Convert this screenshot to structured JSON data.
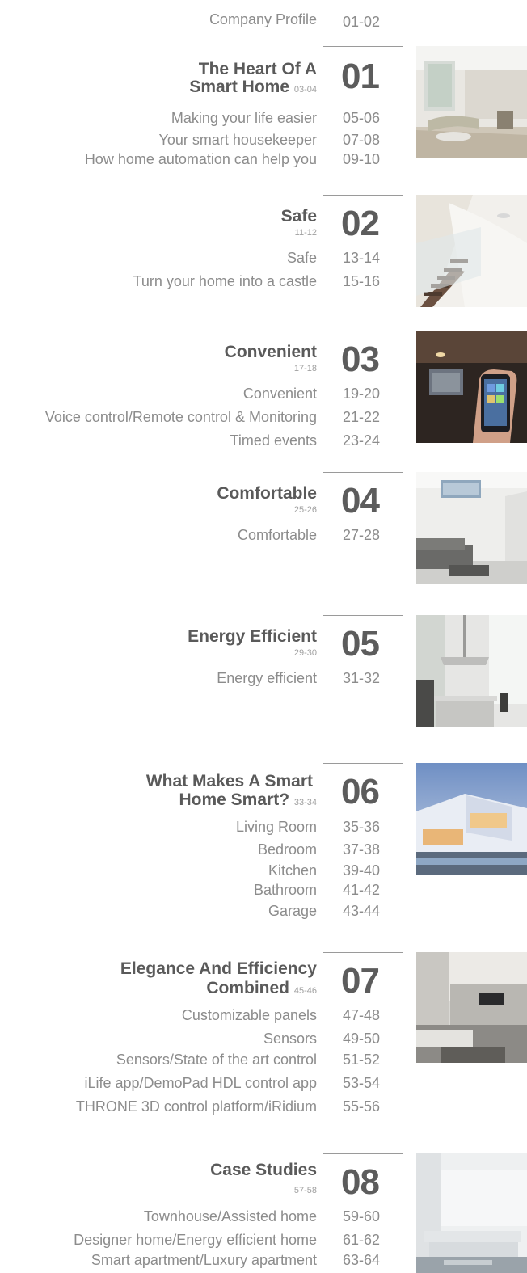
{
  "profile": {
    "label": "Company Profile",
    "pages": "01-02"
  },
  "sections": [
    {
      "num": "01",
      "title_lines": [
        "The Heart Of A",
        "Smart Home"
      ],
      "title_pages": "03-04",
      "items": [
        {
          "label": "Making your life easier",
          "pages": "05-06"
        },
        {
          "label": "Your smart housekeeper",
          "pages": "07-08"
        },
        {
          "label": "How home automation can help you",
          "pages": "09-10"
        }
      ]
    },
    {
      "num": "02",
      "title_lines": [
        "Safe"
      ],
      "title_pages": "11-12",
      "items": [
        {
          "label": "Safe",
          "pages": "13-14"
        },
        {
          "label": "Turn your home into a castle",
          "pages": "15-16"
        }
      ]
    },
    {
      "num": "03",
      "title_lines": [
        "Convenient"
      ],
      "title_pages": "17-18",
      "items": [
        {
          "label": "Convenient",
          "pages": "19-20"
        },
        {
          "label": "Voice control/Remote control & Monitoring",
          "pages": "21-22"
        },
        {
          "label": "Timed events",
          "pages": "23-24"
        }
      ]
    },
    {
      "num": "04",
      "title_lines": [
        "Comfortable"
      ],
      "title_pages": "25-26",
      "items": [
        {
          "label": "Comfortable",
          "pages": "27-28"
        }
      ]
    },
    {
      "num": "05",
      "title_lines": [
        "Energy Efficient"
      ],
      "title_pages": "29-30",
      "items": [
        {
          "label": "Energy efficient",
          "pages": "31-32"
        }
      ]
    },
    {
      "num": "06",
      "title_lines": [
        "What Makes A Smart",
        "Home Smart?"
      ],
      "title_pages": "33-34",
      "items": [
        {
          "label": "Living Room",
          "pages": "35-36"
        },
        {
          "label": "Bedroom",
          "pages": "37-38"
        },
        {
          "label": "Kitchen",
          "pages": "39-40"
        },
        {
          "label": "Bathroom",
          "pages": "41-42"
        },
        {
          "label": "Garage",
          "pages": "43-44"
        }
      ]
    },
    {
      "num": "07",
      "title_lines": [
        "Elegance And Efficiency",
        "Combined"
      ],
      "title_pages": "45-46",
      "items": [
        {
          "label": "Customizable panels",
          "pages": "47-48"
        },
        {
          "label": "Sensors",
          "pages": "49-50"
        },
        {
          "label": "Sensors/State of the art control",
          "pages": "51-52"
        },
        {
          "label": "iLife app/DemoPad HDL control app",
          "pages": "53-54"
        },
        {
          "label": "THRONE 3D control platform/iRidium",
          "pages": "55-56"
        }
      ]
    },
    {
      "num": "08",
      "title_lines": [
        "Case Studies"
      ],
      "title_pages": "57-58",
      "items": [
        {
          "label": "Townhouse/Assisted home",
          "pages": "59-60"
        },
        {
          "label": "Designer home/Energy efficient home",
          "pages": "61-62"
        },
        {
          "label": "Smart apartment/Luxury apartment",
          "pages": "63-64"
        }
      ]
    }
  ]
}
